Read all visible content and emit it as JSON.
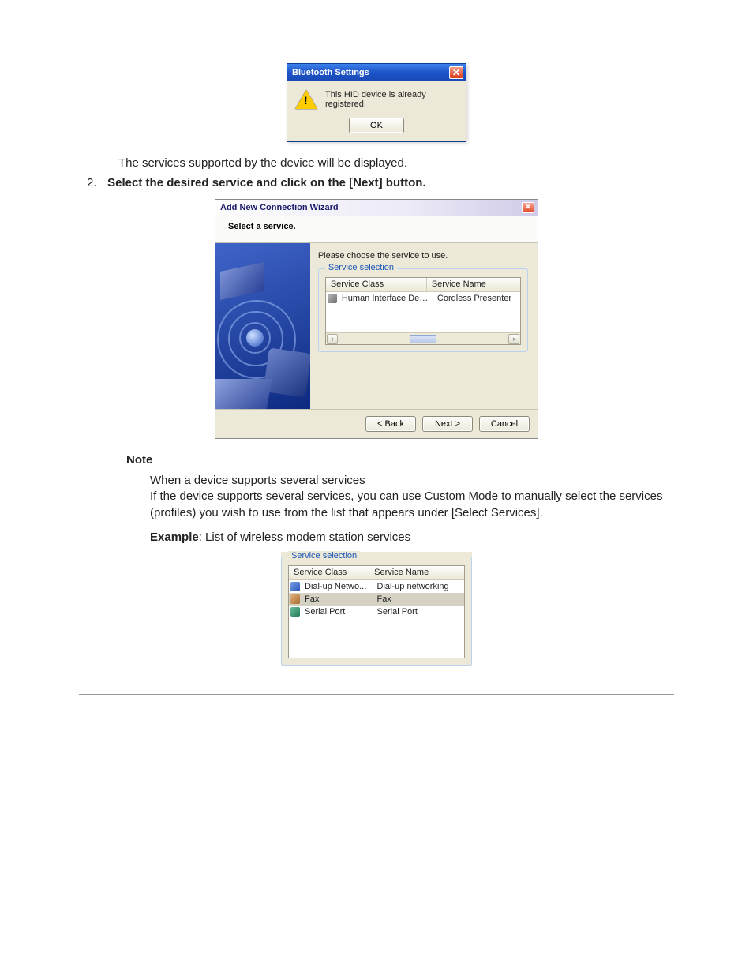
{
  "msgbox": {
    "title": "Bluetooth Settings",
    "message": "This HID device is already registered.",
    "ok": "OK"
  },
  "intro": "The services supported by the device will be displayed.",
  "step2": {
    "number": "2.",
    "text": "Select the desired service and click on the [Next] button."
  },
  "wizard": {
    "title": "Add New Connection Wizard",
    "heading": "Select a service.",
    "instruction": "Please choose the service to use.",
    "groupLegend": "Service selection",
    "columns": {
      "class": "Service Class",
      "name": "Service Name"
    },
    "rows": [
      {
        "class": "Human Interface Device",
        "name": "Cordless Presenter",
        "icon": "hid",
        "selected": false
      }
    ],
    "buttons": {
      "back": "< Back",
      "next": "Next >",
      "cancel": "Cancel"
    }
  },
  "note": {
    "heading": "Note",
    "subheading": "When a device supports several services",
    "body": "If the device supports several services, you can use Custom Mode to manually select the services (profiles) you wish to use from the list that appears under [Select Services]."
  },
  "example": {
    "label": "Example",
    "text": ": List of wireless modem station services"
  },
  "svcExample": {
    "groupLegend": "Service selection",
    "columns": {
      "class": "Service Class",
      "name": "Service Name"
    },
    "rows": [
      {
        "class": "Dial-up Netwo...",
        "name": "Dial-up networking",
        "icon": "dialup",
        "selected": false
      },
      {
        "class": "Fax",
        "name": "Fax",
        "icon": "fax",
        "selected": true
      },
      {
        "class": "Serial Port",
        "name": "Serial Port",
        "icon": "serial",
        "selected": false
      }
    ]
  }
}
